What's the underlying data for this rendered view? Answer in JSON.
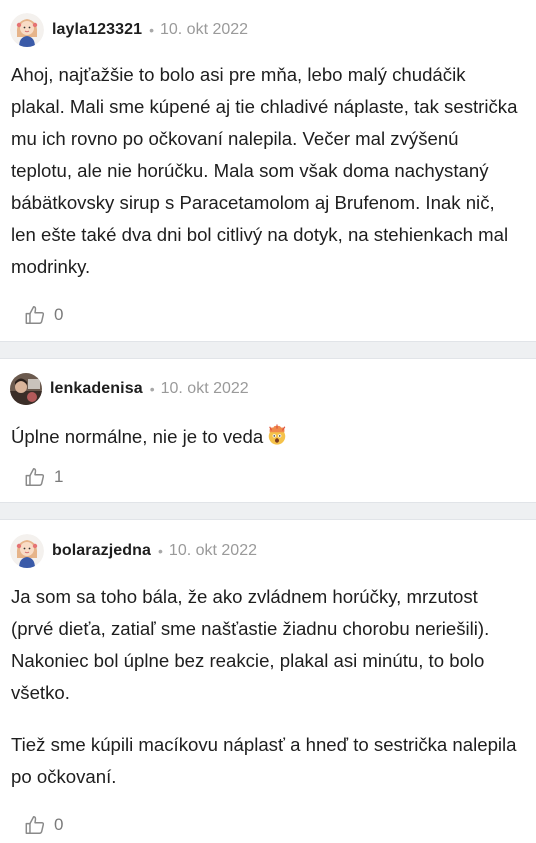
{
  "comments": [
    {
      "username": "layla123321",
      "date": "10. okt 2022",
      "avatar": "girl-avatar-icon",
      "body": "Ahoj, najťažšie to bolo asi pre mňa, lebo malý chudáčik plakal. Mali sme kúpené aj tie chladivé náplaste, tak sestrička mu ich rovno po očkovaní nalepila. Večer mal zvýšenú teplotu, ale nie horúčku. Mala som však doma nachystaný bábätkovsky sirup s Paracetamolom aj Brufenom. Inak nič, len ešte také dva dni bol citlivý na dotyk, na stehienkach mal modrinky.",
      "likes": "0"
    },
    {
      "username": "lenkadenisa",
      "date": "10. okt 2022",
      "avatar": "photo-avatar",
      "body": "Úplne normálne, nie je to veda",
      "emoji": "exploding-head-emoji",
      "likes": "1"
    },
    {
      "username": "bolarazjedna",
      "date": "10. okt 2022",
      "avatar": "girl-avatar-icon",
      "body": "Ja som sa toho bála, že ako zvládnem horúčky, mrzutost (prvé dieťa, zatiaľ sme našťastie žiadnu chorobu neriešili). Nakoniec bol úplne bez reakcie, plakal asi minútu, to bolo všetko.",
      "body2": "Tiež sme kúpili macíkovu náplasť a hneď to sestrička nalepila po očkovaní.",
      "likes": "0"
    }
  ],
  "separator_dot": "•",
  "colors": {
    "text": "#1e1e1e",
    "meta": "#9a9a9a",
    "separator": "#eef0f2",
    "avatar_hair": "#e6b48a",
    "avatar_dress": "#3a5aa8"
  }
}
